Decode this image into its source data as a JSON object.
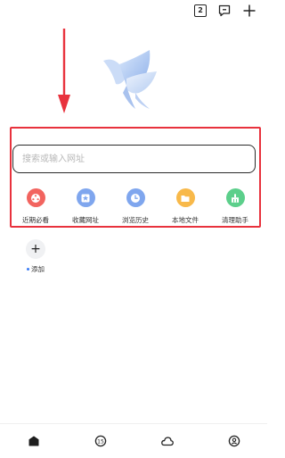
{
  "topbar": {
    "tab_count": "2",
    "icons": [
      "tab-count-icon",
      "message-icon",
      "plus-icon"
    ]
  },
  "search": {
    "placeholder": "搜索或输入网址",
    "value": ""
  },
  "shortcuts": [
    {
      "label": "近期必看",
      "icon": "film-reel-icon",
      "color": "#f2645f"
    },
    {
      "label": "收藏网址",
      "icon": "star-bookmark-icon",
      "color": "#7fa6ee"
    },
    {
      "label": "浏览历史",
      "icon": "clock-icon",
      "color": "#7fa6ee"
    },
    {
      "label": "本地文件",
      "icon": "folder-icon",
      "color": "#f8b94a"
    },
    {
      "label": "清理助手",
      "icon": "broom-icon",
      "color": "#5ccf8b"
    }
  ],
  "add_tile": {
    "symbol": "+",
    "label": "添加"
  },
  "bottom_nav": [
    "home-icon",
    "counter-icon",
    "cloud-icon",
    "profile-icon"
  ],
  "colors": {
    "highlight_border": "#e8323d",
    "arrow": "#e8323d",
    "accent_dot": "#3b7cf6"
  }
}
